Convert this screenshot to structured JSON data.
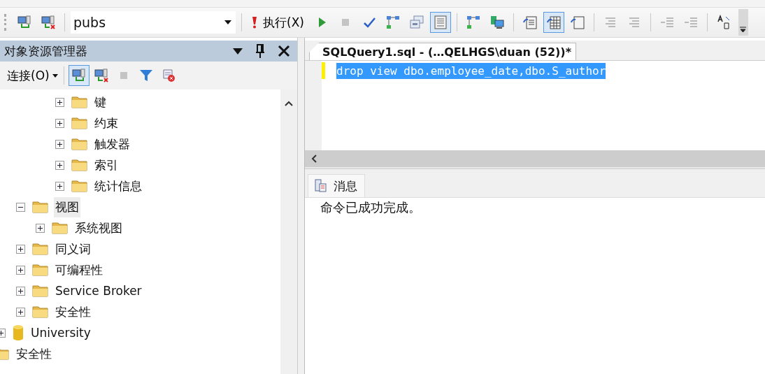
{
  "toolbar": {
    "database": "pubs",
    "execute_label": "执行(X)",
    "buttons": [
      {
        "kind": "connect",
        "pressed": false
      },
      {
        "kind": "disconnect",
        "pressed": false
      }
    ],
    "tools": [
      {
        "kind": "play",
        "pressed": false
      },
      {
        "kind": "stop",
        "pressed": false
      },
      {
        "kind": "check",
        "pressed": false
      },
      {
        "kind": "plan",
        "pressed": false
      },
      {
        "kind": "windows",
        "pressed": false
      },
      {
        "kind": "form",
        "pressed": true
      },
      {
        "kind": "plan",
        "pressed": false
      },
      {
        "kind": "monitor",
        "pressed": false
      },
      {
        "kind": "text",
        "pressed": false
      },
      {
        "kind": "grid",
        "pressed": true
      },
      {
        "kind": "file",
        "pressed": false
      },
      {
        "kind": "comment",
        "pressed": false
      },
      {
        "kind": "uncomment",
        "pressed": false
      },
      {
        "kind": "outdent",
        "pressed": false
      },
      {
        "kind": "indent",
        "pressed": false
      },
      {
        "kind": "params",
        "pressed": false
      }
    ]
  },
  "explorer": {
    "title": "对象资源管理器",
    "connect_label": "连接(O)",
    "tools": [
      {
        "kind": "connect",
        "pressed": true
      },
      {
        "kind": "disconnect",
        "pressed": false
      },
      {
        "kind": "stop",
        "pressed": false
      },
      {
        "kind": "filter",
        "pressed": false
      },
      {
        "kind": "refresh",
        "pressed": false
      }
    ],
    "tree": [
      {
        "children": [
          {
            "children": [
              {
                "children": [
                  {
                    "children": [
                      {
                        "label": "键",
                        "kind": "folder",
                        "expanded": false,
                        "selected": false
                      },
                      {
                        "label": "约束",
                        "kind": "folder",
                        "expanded": false,
                        "selected": false
                      },
                      {
                        "label": "触发器",
                        "kind": "folder",
                        "expanded": false,
                        "selected": false
                      },
                      {
                        "label": "索引",
                        "kind": "folder",
                        "expanded": false,
                        "selected": false
                      },
                      {
                        "label": "统计信息",
                        "kind": "folder",
                        "expanded": false,
                        "selected": false
                      }
                    ]
                  }
                ]
              },
              {
                "label": "视图",
                "kind": "folder",
                "expanded": true,
                "selected": true,
                "children": [
                  {
                    "label": "系统视图",
                    "kind": "folder",
                    "expanded": false,
                    "selected": false
                  }
                ]
              },
              {
                "label": "同义词",
                "kind": "folder",
                "expanded": false,
                "selected": false
              },
              {
                "label": "可编程性",
                "kind": "folder",
                "expanded": false,
                "selected": false
              },
              {
                "label": "Service Broker",
                "kind": "folder",
                "expanded": false,
                "selected": false
              },
              {
                "label": "安全性",
                "kind": "folder",
                "expanded": false,
                "selected": false
              }
            ]
          },
          {
            "label": "University",
            "kind": "database",
            "expanded": false,
            "selected": false
          }
        ]
      },
      {
        "label": "安全性",
        "kind": "folder",
        "selected": false
      }
    ]
  },
  "editor": {
    "tab": "SQLQuery1.sql - (…QELHGS\\duan (52))*",
    "lines": [
      {
        "text": "drop view dbo.employee_date,dbo.S_author",
        "selected": true,
        "changed": true
      }
    ]
  },
  "results": {
    "tab": "消息",
    "message": "命令已成功完成。"
  }
}
